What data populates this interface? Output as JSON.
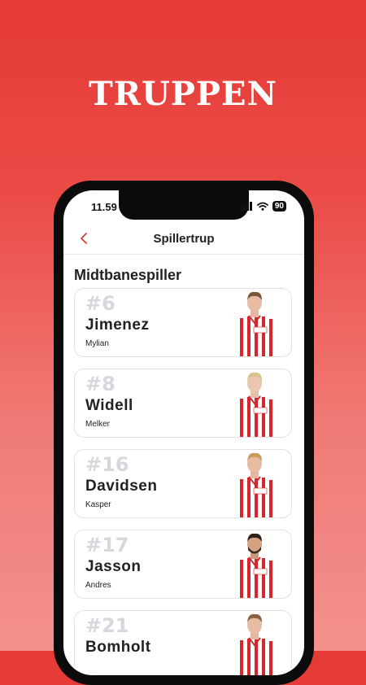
{
  "headline": "TRUPPEN",
  "status_bar": {
    "time": "11.59",
    "battery": "90"
  },
  "navbar": {
    "title": "Spillertrup"
  },
  "section": {
    "title": "Midtbanespiller"
  },
  "players": [
    {
      "number": "#6",
      "last_name": "Jimenez",
      "first_name": "Mylian"
    },
    {
      "number": "#8",
      "last_name": "Widell",
      "first_name": "Melker"
    },
    {
      "number": "#16",
      "last_name": "Davidsen",
      "first_name": "Kasper"
    },
    {
      "number": "#17",
      "last_name": "Jasson",
      "first_name": "Andres"
    },
    {
      "number": "#21",
      "last_name": "Bomholt",
      "first_name": ""
    }
  ],
  "colors": {
    "accent": "#e03a3a",
    "jersey_red": "#d8262b",
    "number_gray": "#d6d8de"
  }
}
